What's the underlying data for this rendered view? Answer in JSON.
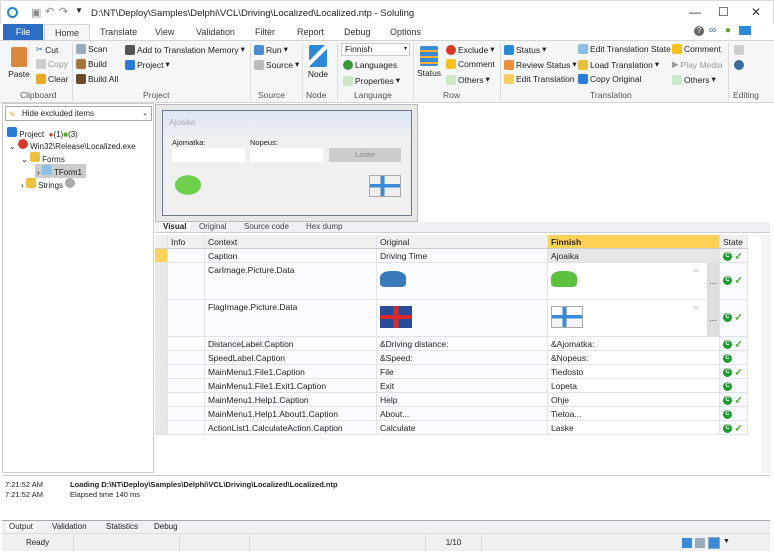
{
  "window": {
    "title": "D:\\NT\\Deploy\\Samples\\Delphi\\VCL\\Driving\\Localized\\Localized.ntp  -  Soluling"
  },
  "tabs": [
    "File",
    "Home",
    "Translate",
    "View",
    "Validation",
    "Filter",
    "Report",
    "Debug",
    "Options"
  ],
  "ribbon": {
    "clipboard": {
      "paste": "Paste",
      "cut": "Cut",
      "copy": "Copy",
      "clear": "Clear",
      "label": "Clipboard"
    },
    "project": {
      "scan": "Scan",
      "build": "Build",
      "build_all": "Build All",
      "add_tm": "Add to Translation Memory",
      "project": "Project",
      "label": "Project"
    },
    "source": {
      "run": "Run",
      "source": "Source",
      "label": "Source"
    },
    "node": {
      "node": "Node",
      "label": "Node"
    },
    "language": {
      "selected": "Finnish",
      "languages": "Languages",
      "properties": "Properties",
      "label": "Language"
    },
    "row": {
      "status": "Status",
      "exclude": "Exclude",
      "comment": "Comment",
      "others": "Others",
      "label": "Row"
    },
    "translation": {
      "status": "Status",
      "review_status": "Review Status",
      "edit_translation": "Edit Translation",
      "edit_state": "Edit Translation State",
      "load_translation": "Load Translation",
      "copy_original": "Copy Original",
      "comment": "Comment",
      "play_media": "Play Media",
      "others": "Others",
      "label": "Translation"
    },
    "editing": {
      "label": "Editing"
    }
  },
  "left": {
    "filter": "Hide excluded items",
    "tree": [
      {
        "label": "Project",
        "extra1": "(1)",
        "extra2": "(3)"
      },
      {
        "label": "Win32\\Release\\Localized.exe"
      },
      {
        "label": "Forms"
      },
      {
        "label": "TForm1"
      },
      {
        "label": "Strings"
      }
    ]
  },
  "designer": {
    "caption": "Ajoaika",
    "distance_label": "Ajomatka:",
    "speed_label": "Nopeus:",
    "button": "Laske"
  },
  "view_tabs": [
    "Visual",
    "Original",
    "Source code",
    "Hex dump"
  ],
  "grid": {
    "headers": {
      "info": "Info",
      "context": "Context",
      "original": "Original",
      "finnish": "Finnish",
      "state": "State"
    },
    "rows": [
      {
        "context": "Caption",
        "original": "Driving Time",
        "finnish": "Ajoaika",
        "check": true
      },
      {
        "context": "CarImage.Picture.Data",
        "original": "",
        "finnish": "",
        "check": true,
        "image": "car"
      },
      {
        "context": "FlagImage.Picture.Data",
        "original": "",
        "finnish": "",
        "check": true,
        "image": "flag"
      },
      {
        "context": "DistanceLabel.Caption",
        "original": "&Driving distance:",
        "finnish": "&Ajomatka:",
        "check": true
      },
      {
        "context": "SpeedLabel.Caption",
        "original": "&Speed:",
        "finnish": "&Nopeus:",
        "check": false
      },
      {
        "context": "MainMenu1.File1.Caption",
        "original": "File",
        "finnish": "Tiedosto",
        "check": true
      },
      {
        "context": "MainMenu1.File1.Exit1.Caption",
        "original": "Exit",
        "finnish": "Lopeta",
        "check": false
      },
      {
        "context": "MainMenu1.Help1.Caption",
        "original": "Help",
        "finnish": "Ohje",
        "check": true
      },
      {
        "context": "MainMenu1.Help1.About1.Caption",
        "original": "About...",
        "finnish": "Tietoa...",
        "check": false
      },
      {
        "context": "ActionList1.CalculateAction.Caption",
        "original": "Calculate",
        "finnish": "Laske",
        "check": true
      }
    ]
  },
  "output": {
    "lines": [
      {
        "time": "7:21:52 AM",
        "text": "Loading D:\\NT\\Deploy\\Samples\\Delphi\\VCL\\Driving\\Localized\\Localized.ntp"
      },
      {
        "time": "7:21:52 AM",
        "text": "Elapsed time 140 ms"
      }
    ]
  },
  "output_tabs": [
    "Output",
    "Validation",
    "Statistics",
    "Debug"
  ],
  "status": {
    "state": "Ready",
    "position": "1/10"
  },
  "colors": {
    "accent": "#2b6cc4",
    "finnish_header": "#ffd257",
    "state_ok": "#1a9c2f"
  }
}
